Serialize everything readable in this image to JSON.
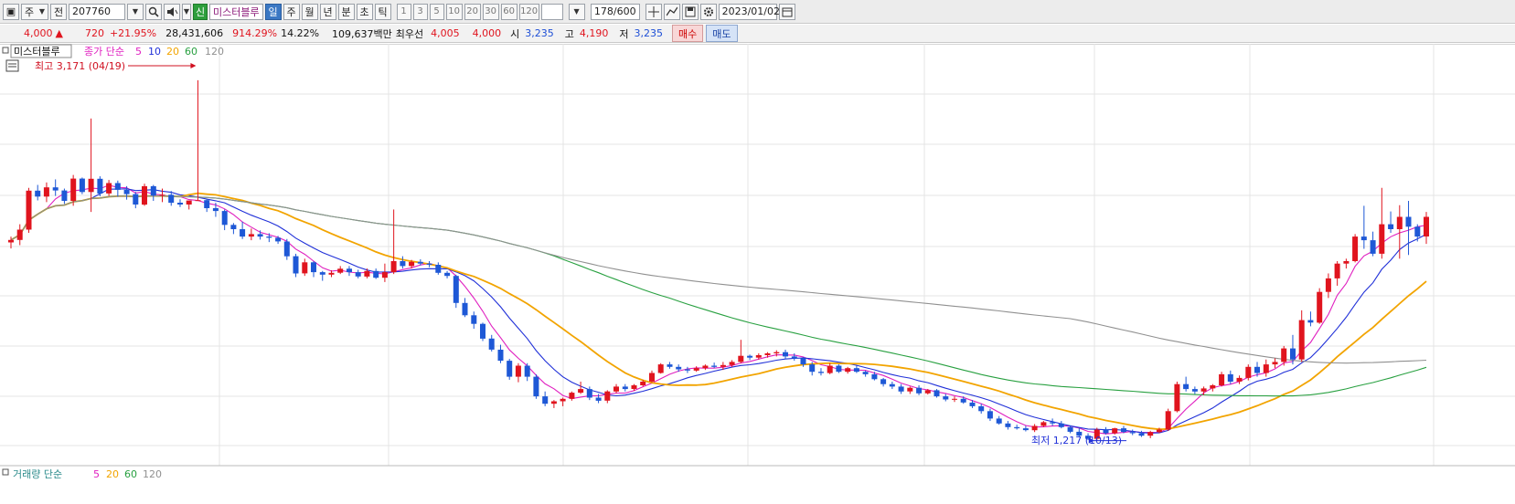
{
  "toolbar": {
    "chart_btn": "▣",
    "type": "주",
    "scope": "전",
    "code": "207760",
    "search_icon": "magnifier-icon",
    "sound_icon": "speaker-icon",
    "badge": "신",
    "name": "미스터블루",
    "period_day": "일",
    "period_week": "주",
    "period_month": "월",
    "period_year": "년",
    "period_min": "분",
    "period_sec": "초",
    "period_tick": "틱",
    "intervals": [
      "1",
      "3",
      "5",
      "10",
      "20",
      "30",
      "60",
      "120"
    ],
    "count": "178/600",
    "date": "2023/01/02"
  },
  "info": {
    "price": "4,000",
    "arrow": "▲",
    "change": "720",
    "change_pct": "+21.95%",
    "volume": "28,431,606",
    "vol_ratio": "914.29%",
    "turnover": "14.22%",
    "amount": "109,637백만",
    "bid_label": "최우선",
    "bid": "4,005",
    "ask": "4,000",
    "open_label": "시",
    "open": "3,235",
    "high_label": "고",
    "high": "4,190",
    "low_label": "저",
    "low": "3,235",
    "buy_btn": "매수",
    "sell_btn": "매도"
  },
  "chart_data": {
    "type": "candlestick",
    "legend": {
      "name": "미스터블루",
      "label": "종가 단순",
      "periods": [
        "5",
        "10",
        "20",
        "60",
        "120"
      ],
      "colors": [
        "#e020c0",
        "#2030d8",
        "#f2a400",
        "#28a040",
        "#909090"
      ]
    },
    "annotations": {
      "high": "최고 3,171 (04/19)",
      "low": "최저 1,217 (10/13)"
    },
    "volume_legend": {
      "label": "거래량 단순",
      "periods": [
        "5",
        "20",
        "60",
        "120"
      ]
    },
    "candles": [
      [
        1852,
        1900,
        1803,
        1872
      ],
      [
        1872,
        2000,
        1830,
        1956
      ],
      [
        1956,
        2296,
        1930,
        2273
      ],
      [
        2273,
        2320,
        2194,
        2225
      ],
      [
        2225,
        2340,
        2180,
        2300
      ],
      [
        2300,
        2365,
        2230,
        2275
      ],
      [
        2275,
        2290,
        2165,
        2190
      ],
      [
        2190,
        2401,
        2150,
        2371
      ],
      [
        2371,
        2380,
        2245,
        2262
      ],
      [
        2262,
        2860,
        2100,
        2370
      ],
      [
        2370,
        2390,
        2227,
        2250
      ],
      [
        2250,
        2360,
        2230,
        2335
      ],
      [
        2335,
        2355,
        2223,
        2280
      ],
      [
        2280,
        2310,
        2200,
        2245
      ],
      [
        2245,
        2263,
        2130,
        2160
      ],
      [
        2160,
        2330,
        2150,
        2310
      ],
      [
        2310,
        2320,
        2190,
        2235
      ],
      [
        2235,
        2290,
        2180,
        2240
      ],
      [
        2240,
        2270,
        2150,
        2175
      ],
      [
        2175,
        2203,
        2140,
        2160
      ],
      [
        2160,
        2180,
        2120,
        2193
      ],
      [
        2193,
        3171,
        2190,
        2196
      ],
      [
        2196,
        2205,
        2100,
        2131
      ],
      [
        2131,
        2175,
        2060,
        2108
      ],
      [
        2108,
        2120,
        1952,
        1995
      ],
      [
        1995,
        2010,
        1920,
        1960
      ],
      [
        1960,
        2021,
        1880,
        1900
      ],
      [
        1900,
        1965,
        1870,
        1920
      ],
      [
        1920,
        1950,
        1875,
        1900
      ],
      [
        1900,
        1927,
        1855,
        1890
      ],
      [
        1890,
        1905,
        1840,
        1860
      ],
      [
        1860,
        1880,
        1710,
        1740
      ],
      [
        1740,
        1760,
        1570,
        1600
      ],
      [
        1600,
        1720,
        1580,
        1690
      ],
      [
        1690,
        1700,
        1570,
        1610
      ],
      [
        1610,
        1620,
        1540,
        1590
      ],
      [
        1590,
        1625,
        1570,
        1605
      ],
      [
        1605,
        1660,
        1595,
        1638
      ],
      [
        1638,
        1660,
        1580,
        1610
      ],
      [
        1610,
        1630,
        1560,
        1575
      ],
      [
        1575,
        1640,
        1560,
        1620
      ],
      [
        1620,
        1640,
        1555,
        1565
      ],
      [
        1565,
        1680,
        1530,
        1610
      ],
      [
        1610,
        2120,
        1595,
        1700
      ],
      [
        1700,
        1740,
        1640,
        1660
      ],
      [
        1660,
        1710,
        1640,
        1694
      ],
      [
        1694,
        1715,
        1665,
        1680
      ],
      [
        1680,
        1700,
        1650,
        1670
      ],
      [
        1670,
        1690,
        1590,
        1605
      ],
      [
        1605,
        1620,
        1560,
        1580
      ],
      [
        1580,
        1590,
        1320,
        1360
      ],
      [
        1360,
        1400,
        1245,
        1260
      ],
      [
        1260,
        1290,
        1150,
        1190
      ],
      [
        1190,
        1200,
        1050,
        1070
      ],
      [
        1070,
        1100,
        965,
        980
      ],
      [
        980,
        1020,
        870,
        890
      ],
      [
        890,
        905,
        735,
        760
      ],
      [
        760,
        870,
        715,
        850
      ],
      [
        850,
        870,
        725,
        760
      ],
      [
        760,
        780,
        580,
        600
      ],
      [
        600,
        640,
        520,
        540
      ],
      [
        540,
        570,
        505,
        560
      ],
      [
        560,
        590,
        520,
        580
      ],
      [
        580,
        640,
        565,
        630
      ],
      [
        630,
        720,
        620,
        660
      ],
      [
        660,
        680,
        570,
        590
      ],
      [
        590,
        620,
        545,
        565
      ],
      [
        565,
        650,
        545,
        640
      ],
      [
        640,
        700,
        625,
        680
      ],
      [
        680,
        700,
        640,
        660
      ],
      [
        660,
        700,
        645,
        690
      ],
      [
        690,
        735,
        680,
        720
      ],
      [
        720,
        810,
        710,
        790
      ],
      [
        790,
        870,
        785,
        860
      ],
      [
        860,
        880,
        825,
        840
      ],
      [
        840,
        860,
        800,
        820
      ],
      [
        820,
        840,
        790,
        810
      ],
      [
        810,
        845,
        800,
        830
      ],
      [
        830,
        860,
        815,
        850
      ],
      [
        850,
        875,
        830,
        840
      ],
      [
        840,
        880,
        815,
        855
      ],
      [
        855,
        895,
        840,
        880
      ],
      [
        880,
        1060,
        870,
        930
      ],
      [
        930,
        940,
        895,
        915
      ],
      [
        915,
        950,
        900,
        935
      ],
      [
        935,
        960,
        915,
        950
      ],
      [
        950,
        975,
        925,
        960
      ],
      [
        960,
        980,
        905,
        925
      ],
      [
        925,
        950,
        890,
        910
      ],
      [
        910,
        920,
        840,
        860
      ],
      [
        860,
        880,
        770,
        800
      ],
      [
        800,
        830,
        770,
        790
      ],
      [
        790,
        870,
        780,
        850
      ],
      [
        850,
        860,
        790,
        800
      ],
      [
        800,
        840,
        785,
        830
      ],
      [
        830,
        850,
        790,
        800
      ],
      [
        800,
        810,
        760,
        780
      ],
      [
        780,
        800,
        730,
        740
      ],
      [
        740,
        750,
        680,
        700
      ],
      [
        700,
        720,
        660,
        680
      ],
      [
        680,
        700,
        620,
        640
      ],
      [
        640,
        680,
        620,
        670
      ],
      [
        670,
        690,
        610,
        625
      ],
      [
        625,
        660,
        615,
        650
      ],
      [
        650,
        660,
        590,
        600
      ],
      [
        600,
        620,
        560,
        575
      ],
      [
        575,
        600,
        555,
        580
      ],
      [
        580,
        600,
        540,
        550
      ],
      [
        550,
        570,
        505,
        520
      ],
      [
        520,
        540,
        460,
        480
      ],
      [
        480,
        500,
        400,
        420
      ],
      [
        420,
        440,
        370,
        380
      ],
      [
        380,
        400,
        330,
        350
      ],
      [
        350,
        370,
        330,
        340
      ],
      [
        340,
        360,
        315,
        325
      ],
      [
        325,
        375,
        310,
        360
      ],
      [
        360,
        400,
        350,
        390
      ],
      [
        390,
        420,
        360,
        380
      ],
      [
        380,
        400,
        340,
        350
      ],
      [
        350,
        365,
        300,
        312
      ],
      [
        312,
        340,
        270,
        280
      ],
      [
        280,
        300,
        245,
        255
      ],
      [
        255,
        345,
        240,
        330
      ],
      [
        330,
        350,
        290,
        300
      ],
      [
        300,
        345,
        290,
        340
      ],
      [
        340,
        360,
        300,
        310
      ],
      [
        310,
        330,
        285,
        300
      ],
      [
        300,
        320,
        270,
        280
      ],
      [
        280,
        320,
        260,
        310
      ],
      [
        310,
        345,
        300,
        330
      ],
      [
        330,
        500,
        320,
        480
      ],
      [
        480,
        720,
        470,
        700
      ],
      [
        700,
        760,
        640,
        660
      ],
      [
        660,
        680,
        620,
        640
      ],
      [
        640,
        680,
        610,
        665
      ],
      [
        665,
        700,
        640,
        690
      ],
      [
        690,
        800,
        680,
        780
      ],
      [
        780,
        810,
        700,
        720
      ],
      [
        720,
        770,
        700,
        750
      ],
      [
        750,
        860,
        730,
        840
      ],
      [
        840,
        880,
        760,
        790
      ],
      [
        790,
        900,
        760,
        860
      ],
      [
        860,
        910,
        830,
        880
      ],
      [
        880,
        1010,
        850,
        990
      ],
      [
        990,
        1100,
        860,
        900
      ],
      [
        900,
        1300,
        880,
        1220
      ],
      [
        1220,
        1290,
        1170,
        1200
      ],
      [
        1200,
        1480,
        1190,
        1450
      ],
      [
        1450,
        1600,
        1400,
        1560
      ],
      [
        1560,
        1700,
        1500,
        1680
      ],
      [
        1680,
        1720,
        1640,
        1700
      ],
      [
        1700,
        1920,
        1690,
        1900
      ],
      [
        1900,
        2150,
        1800,
        1870
      ],
      [
        1870,
        1940,
        1740,
        1760
      ],
      [
        1760,
        2296,
        1720,
        2000
      ],
      [
        2000,
        2104,
        1930,
        1960
      ],
      [
        1960,
        2155,
        1720,
        2060
      ],
      [
        2060,
        2190,
        1750,
        1980
      ],
      [
        1980,
        2000,
        1860,
        1900
      ],
      [
        1900,
        2100,
        1840,
        2060
      ]
    ]
  }
}
